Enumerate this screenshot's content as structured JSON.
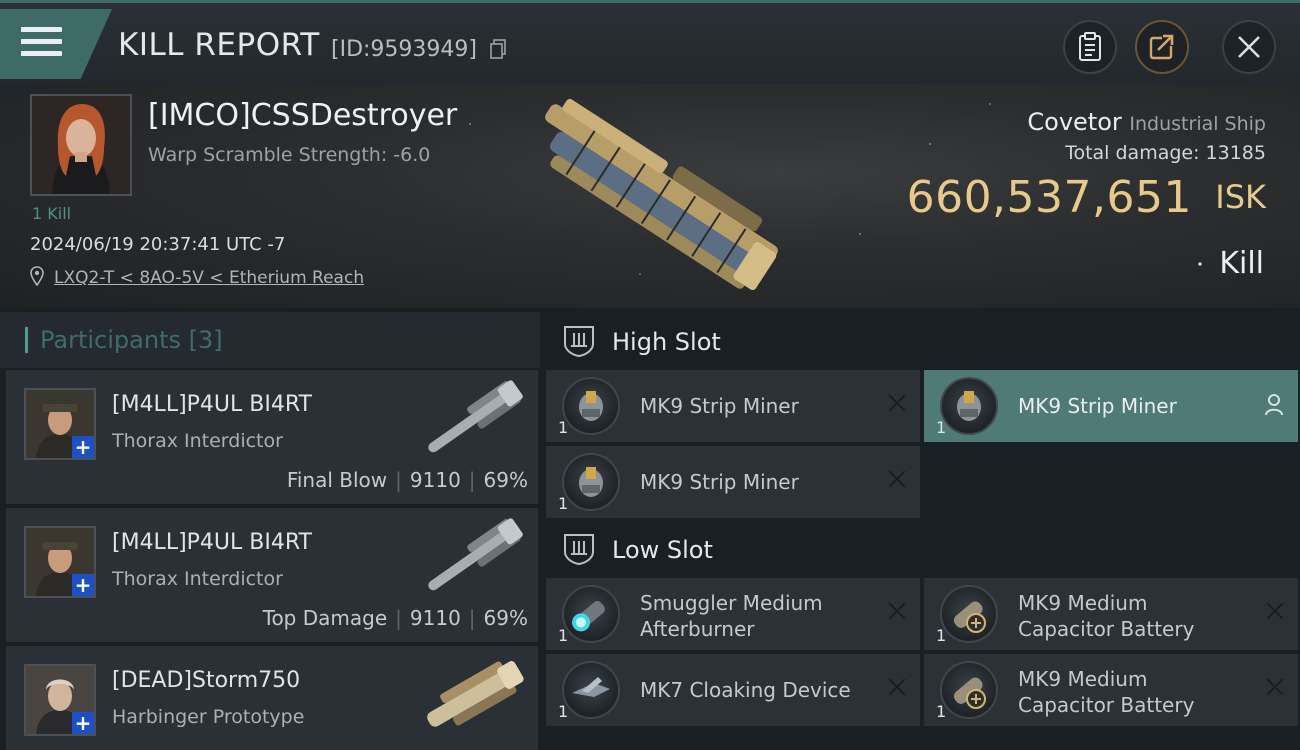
{
  "header": {
    "title": "KILL REPORT",
    "report_id": "[ID:9593949]"
  },
  "victim": {
    "name": "[IMCO]CSSDestroyer",
    "warp_scramble": "Warp Scramble Strength: -6.0",
    "kill_count": "1 Kill",
    "timestamp": "2024/06/19 20:37:41 UTC -7",
    "location": "LXQ2-T < 8AO-5V < Etherium Reach",
    "ship_name": "Covetor",
    "ship_type": "Industrial Ship",
    "total_damage_label": "Total damage:",
    "total_damage_value": "13185",
    "isk_value": "660,537,651",
    "isk_unit": "ISK",
    "kill_type": "Kill"
  },
  "participants": {
    "label": "Participants",
    "count": "[3]",
    "items": [
      {
        "name": "[M4LL]P4UL BI4RT",
        "ship": "Thorax Interdictor",
        "role": "Final Blow",
        "damage": "9110",
        "percent": "69%"
      },
      {
        "name": "[M4LL]P4UL BI4RT",
        "ship": "Thorax Interdictor",
        "role": "Top Damage",
        "damage": "9110",
        "percent": "69%"
      },
      {
        "name": "[DEAD]Storm750",
        "ship": "Harbinger Prototype",
        "role": "",
        "damage": "",
        "percent": ""
      }
    ]
  },
  "slots": {
    "high": {
      "title": "High Slot",
      "modules": [
        {
          "name": "MK9 Strip Miner",
          "qty": "1",
          "icon": "strip-miner-icon"
        },
        {
          "name": "MK9 Strip Miner",
          "qty": "1",
          "icon": "strip-miner-icon"
        },
        {
          "name": "MK9 Strip Miner",
          "qty": "1",
          "icon": "strip-miner-icon"
        }
      ]
    },
    "low": {
      "title": "Low Slot",
      "modules": [
        {
          "line1": "Smuggler Medium",
          "line2": "Afterburner",
          "qty": "1",
          "icon": "afterburner-icon"
        },
        {
          "line1": "MK9 Medium",
          "line2": "Capacitor Battery",
          "qty": "1",
          "icon": "capacitor-battery-icon"
        },
        {
          "name": "MK7 Cloaking Device",
          "qty": "1",
          "icon": "cloaking-device-icon"
        },
        {
          "line1": "MK9 Medium",
          "line2": "Capacitor Battery",
          "qty": "1",
          "icon": "capacitor-battery-icon"
        }
      ]
    }
  },
  "colors": {
    "accent_teal": "#4f7a75",
    "isk_gold": "#e7c98c",
    "plus_blue": "#1f4fc4"
  }
}
